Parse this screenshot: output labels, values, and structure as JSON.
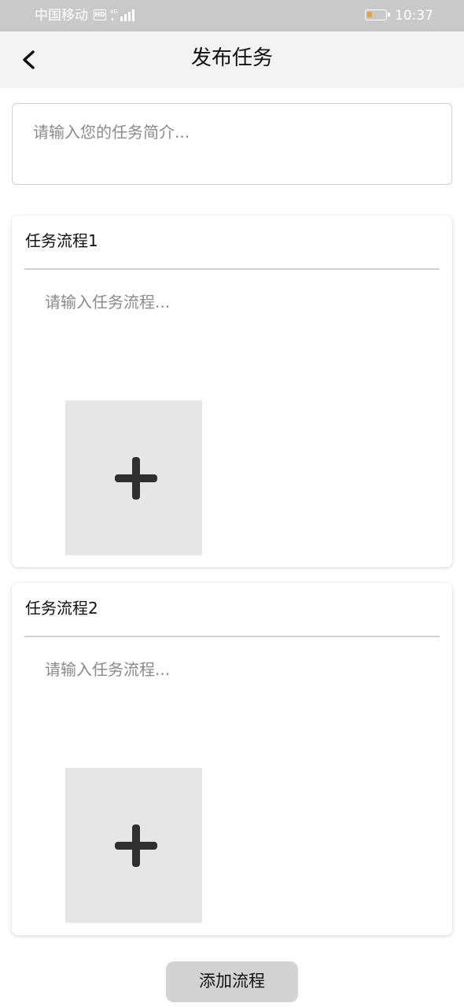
{
  "status_bar": {
    "carrier": "中国移动",
    "hd_badge": "HD",
    "time": "10:37",
    "icons": [
      "hd-icon",
      "signal-icon",
      "battery-icon"
    ]
  },
  "header": {
    "title": "发布任务",
    "back_icon": "chevron-left-icon"
  },
  "intro_input": {
    "placeholder": "请输入您的任务简介..."
  },
  "flows": [
    {
      "title": "任务流程1",
      "placeholder": "请输入任务流程...",
      "add_icon": "plus-icon"
    },
    {
      "title": "任务流程2",
      "placeholder": "请输入任务流程...",
      "add_icon": "plus-icon"
    }
  ],
  "add_flow_button": {
    "label": "添加流程"
  },
  "colors": {
    "status_bar_bg": "#c9c9c9",
    "header_bg": "#f3f3f3",
    "placeholder_text": "#8a8a8a",
    "image_slot_bg": "#e6e6e6",
    "button_bg": "#d3d3d3",
    "battery_level": "#f0a030"
  }
}
